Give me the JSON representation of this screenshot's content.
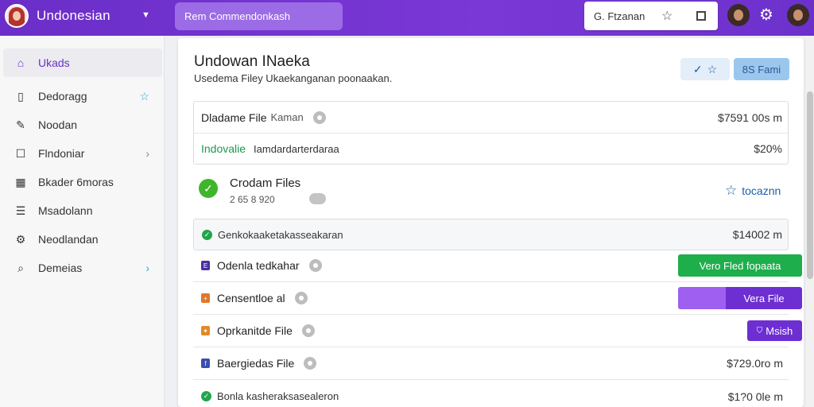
{
  "header": {
    "brand_name": "Undonesian",
    "search_text": "Rem Commendonkash",
    "box_text": "G. Ftzanan"
  },
  "sidebar": {
    "items": [
      {
        "label": "Ukads",
        "icon": "home-icon",
        "active": true
      },
      {
        "label": "Dedoragg",
        "icon": "clipboard-icon",
        "right": "star-icon"
      },
      {
        "label": "Noodan",
        "icon": "pencil-icon"
      },
      {
        "label": "Flndoniar",
        "icon": "square-icon",
        "right": "chevron-right-icon"
      },
      {
        "label": "Bkader 6moras",
        "icon": "calendar-icon"
      },
      {
        "label": "Msadolann",
        "icon": "list-icon"
      },
      {
        "label": "Neodlandan",
        "icon": "gear-icon"
      },
      {
        "label": "Demeias",
        "icon": "search-icon",
        "right": "chevron-right-icon"
      }
    ]
  },
  "main": {
    "title": "Undowan INaeka",
    "subtitle": "Usedema Filey Ukaekanganan poonaakan.",
    "btn_blue": "8S Fami",
    "summary": {
      "row1_label": "Dladame File",
      "row1_sub": "Kaman",
      "row1_amount": "$7591 00s m",
      "row2_label": "Indovalie",
      "row2_sub": "Iamdardarterdaraa",
      "row2_amount": "$20%"
    },
    "section": {
      "title": "Crodam Files",
      "count": "2 65 8 920",
      "action": "tocaznn"
    },
    "highlight": {
      "label": "Genkokaaketakasseakaran",
      "amount": "$14002 m"
    },
    "files": [
      {
        "name": "Odenla tedkahar",
        "action": "Vero Fled fopaata",
        "icon_color": "#4a2fa0",
        "icon_glyph": "E"
      },
      {
        "name": "Censentloe al",
        "action": "Vera File",
        "icon_color": "#e0762a",
        "icon_glyph": "+"
      },
      {
        "name": "Oprkanitde File",
        "action": "Msish",
        "icon_color": "#e08a2a",
        "icon_glyph": "✦"
      },
      {
        "name": "Baergiedas File",
        "amount": "$729.0ro m",
        "icon_color": "#3a4fb0",
        "icon_glyph": "f"
      }
    ],
    "last_row": {
      "label": "Bonla kasheraksasealeron",
      "amount": "$1?0 0le m"
    }
  },
  "colors": {
    "topbar": "#6a2fc9",
    "accent_green": "#1fae4c",
    "accent_purple": "#6d2fd2"
  }
}
